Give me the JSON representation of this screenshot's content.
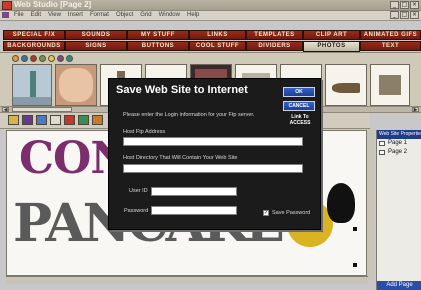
{
  "window": {
    "title": "Web Studio  [Page 2]",
    "buttons": [
      "_",
      "□",
      "×"
    ]
  },
  "menu": {
    "items": [
      "File",
      "Edit",
      "View",
      "Insert",
      "Format",
      "Object",
      "Grid",
      "Window",
      "Help"
    ],
    "window_buttons": [
      "_",
      "□",
      "×"
    ]
  },
  "tabs_row1": [
    "SPECIAL F/X",
    "SOUNDS",
    "MY STUFF",
    "LINKS",
    "TEMPLATES",
    "CLIP ART",
    "ANIMATED GIFS"
  ],
  "tabs_row2": [
    "BACKGROUNDS",
    "SIGNS",
    "BUTTONS",
    "COOL STUFF",
    "DIVIDERS",
    "PHOTOS",
    "TEXT"
  ],
  "active_tab": "PHOTOS",
  "canvas": {
    "headline_top": "CON",
    "headline_bottom": "PANCAKE"
  },
  "panel": {
    "title": "Web Site Properties",
    "pages": [
      "Page 1",
      "Page 2"
    ],
    "add_page": "Add Page"
  },
  "dialog": {
    "title": "Save Web Site to Internet",
    "ok": "OK",
    "cancel": "CANCEL",
    "link_to": "Link To",
    "link_brand": "ACCESS",
    "intro": "Please enter the Login information for your Ftp server.",
    "host_label": "Host Ftp Address",
    "host_value": "",
    "dir_label": "Host Directory That Will Contain Your Web Site",
    "dir_value": "",
    "user_label": "User ID",
    "user_value": "",
    "pass_label": "Password",
    "pass_value": "",
    "save_password_label": "Save Password",
    "save_password_checked": true
  },
  "colors": {
    "tab": "#7a2214",
    "dialog_bg": "#1b1b1b",
    "button_blue": "#2a4ea8",
    "panel_header": "#1f3c8a"
  }
}
